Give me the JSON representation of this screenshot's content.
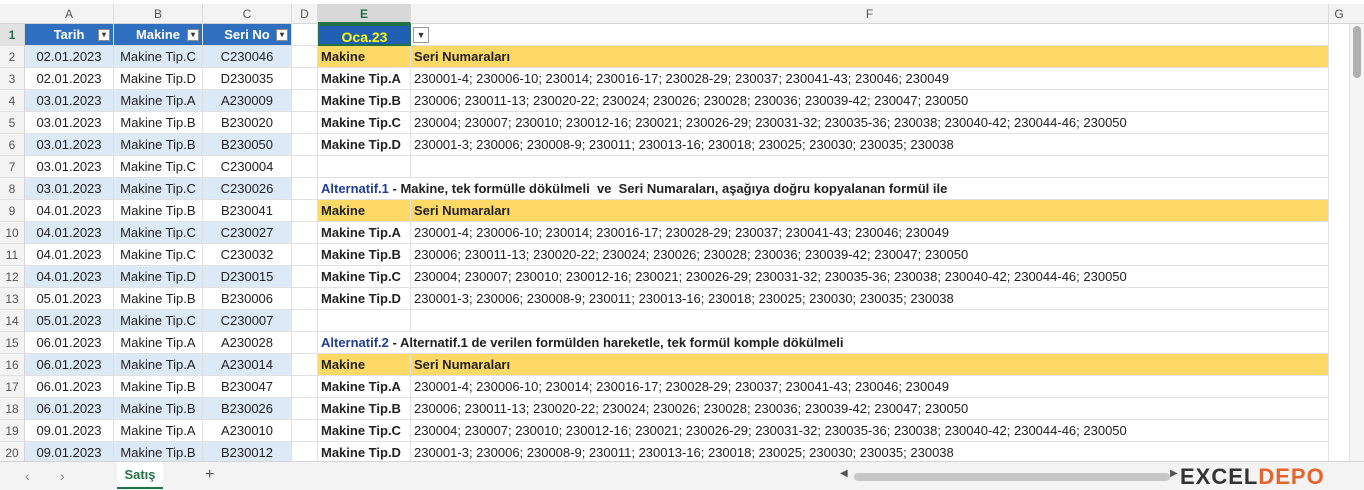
{
  "columns": [
    "A",
    "B",
    "C",
    "D",
    "E",
    "F",
    "G"
  ],
  "rows": [
    "1",
    "2",
    "3",
    "4",
    "5",
    "6",
    "7",
    "8",
    "9",
    "10",
    "11",
    "12",
    "13",
    "14",
    "15",
    "16",
    "17",
    "18",
    "19",
    "20"
  ],
  "table": {
    "headers": [
      "Tarih",
      "Makine",
      "Seri No"
    ],
    "rows": [
      [
        "02.01.2023",
        "Makine Tip.C",
        "C230046"
      ],
      [
        "02.01.2023",
        "Makine Tip.D",
        "D230035"
      ],
      [
        "03.01.2023",
        "Makine Tip.A",
        "A230009"
      ],
      [
        "03.01.2023",
        "Makine Tip.B",
        "B230020"
      ],
      [
        "03.01.2023",
        "Makine Tip.B",
        "B230050"
      ],
      [
        "03.01.2023",
        "Makine Tip.C",
        "C230004"
      ],
      [
        "03.01.2023",
        "Makine Tip.C",
        "C230026"
      ],
      [
        "04.01.2023",
        "Makine Tip.B",
        "B230041"
      ],
      [
        "04.01.2023",
        "Makine Tip.C",
        "C230027"
      ],
      [
        "04.01.2023",
        "Makine Tip.C",
        "C230032"
      ],
      [
        "04.01.2023",
        "Makine Tip.D",
        "D230015"
      ],
      [
        "05.01.2023",
        "Makine Tip.B",
        "B230006"
      ],
      [
        "05.01.2023",
        "Makine Tip.C",
        "C230007"
      ],
      [
        "06.01.2023",
        "Makine Tip.A",
        "A230028"
      ],
      [
        "06.01.2023",
        "Makine Tip.A",
        "A230014"
      ],
      [
        "06.01.2023",
        "Makine Tip.B",
        "B230047"
      ],
      [
        "06.01.2023",
        "Makine Tip.B",
        "B230026"
      ],
      [
        "09.01.2023",
        "Makine Tip.A",
        "A230010"
      ],
      [
        "09.01.2023",
        "Makine Tip.B",
        "B230012"
      ]
    ]
  },
  "selector": {
    "value": "Oca.23"
  },
  "result": {
    "head_makine": "Makine",
    "head_seri": "Seri Numaraları",
    "rows": [
      [
        "Makine Tip.A",
        "230001-4; 230006-10; 230014; 230016-17; 230028-29; 230037; 230041-43; 230046; 230049"
      ],
      [
        "Makine Tip.B",
        "230006; 230011-13; 230020-22; 230024; 230026; 230028; 230036; 230039-42; 230047; 230050"
      ],
      [
        "Makine Tip.C",
        "230004; 230007; 230010; 230012-16; 230021; 230026-29; 230031-32; 230035-36; 230038; 230040-42; 230044-46; 230050"
      ],
      [
        "Makine Tip.D",
        "230001-3; 230006; 230008-9; 230011; 230013-16; 230018; 230025; 230030; 230035; 230038"
      ]
    ]
  },
  "alt1": {
    "label": "Alternatif.1",
    "text": " - Makine, tek formülle dökülmeli  ve  Seri Numaraları, aşağıya doğru kopyalanan formül ile"
  },
  "alt2": {
    "label": "Alternatif.2",
    "text": " - Alternatif.1 de verilen formülden hareketle, tek formül komple dökülmeli"
  },
  "sheet_tab": "Satış",
  "logo": {
    "part1": "EXCEL",
    "part2": "DEPO"
  },
  "colors": {
    "table_header": "#2f6fc0",
    "band": "#dce9f7",
    "yellow": "#ffd966",
    "accent": "#217346"
  }
}
